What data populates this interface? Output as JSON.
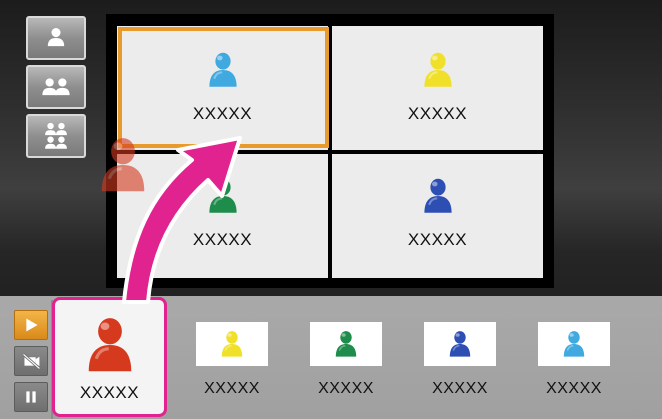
{
  "layout_selector": {
    "items": [
      {
        "name": "single-layout-button",
        "icon": "single-person-icon"
      },
      {
        "name": "dual-layout-button",
        "icon": "two-persons-icon"
      },
      {
        "name": "quad-layout-button",
        "icon": "four-persons-icon"
      }
    ],
    "selected": "quad-layout-button"
  },
  "grid": {
    "cells": [
      {
        "label": "XXXXX",
        "avatar_color": "#3fa9e0",
        "selected": true
      },
      {
        "label": "XXXXX",
        "avatar_color": "#f1e02a",
        "selected": false
      },
      {
        "label": "XXXXX",
        "avatar_color": "#1e8c4a",
        "selected": false
      },
      {
        "label": "XXXXX",
        "avatar_color": "#2d4fb4",
        "selected": false
      }
    ]
  },
  "tray": {
    "controls": [
      {
        "name": "play-button",
        "icon": "play-icon",
        "active": true
      },
      {
        "name": "camera-off-button",
        "icon": "camera-off-icon",
        "active": false
      },
      {
        "name": "pause-button",
        "icon": "pause-icon",
        "active": false
      }
    ],
    "items": [
      {
        "label": "XXXXX",
        "avatar_color": "#d63a1e",
        "active": true
      },
      {
        "label": "XXXXX",
        "avatar_color": "#f1e02a",
        "active": false
      },
      {
        "label": "XXXXX",
        "avatar_color": "#1e8c4a",
        "active": false
      },
      {
        "label": "XXXXX",
        "avatar_color": "#2d4fb4",
        "active": false
      },
      {
        "label": "XXXXX",
        "avatar_color": "#3fa9e0",
        "active": false
      }
    ]
  },
  "drag": {
    "source_avatar_color": "#d63a1e",
    "arrow_color": "#e0238f",
    "highlight_color": "#e89a2c"
  }
}
